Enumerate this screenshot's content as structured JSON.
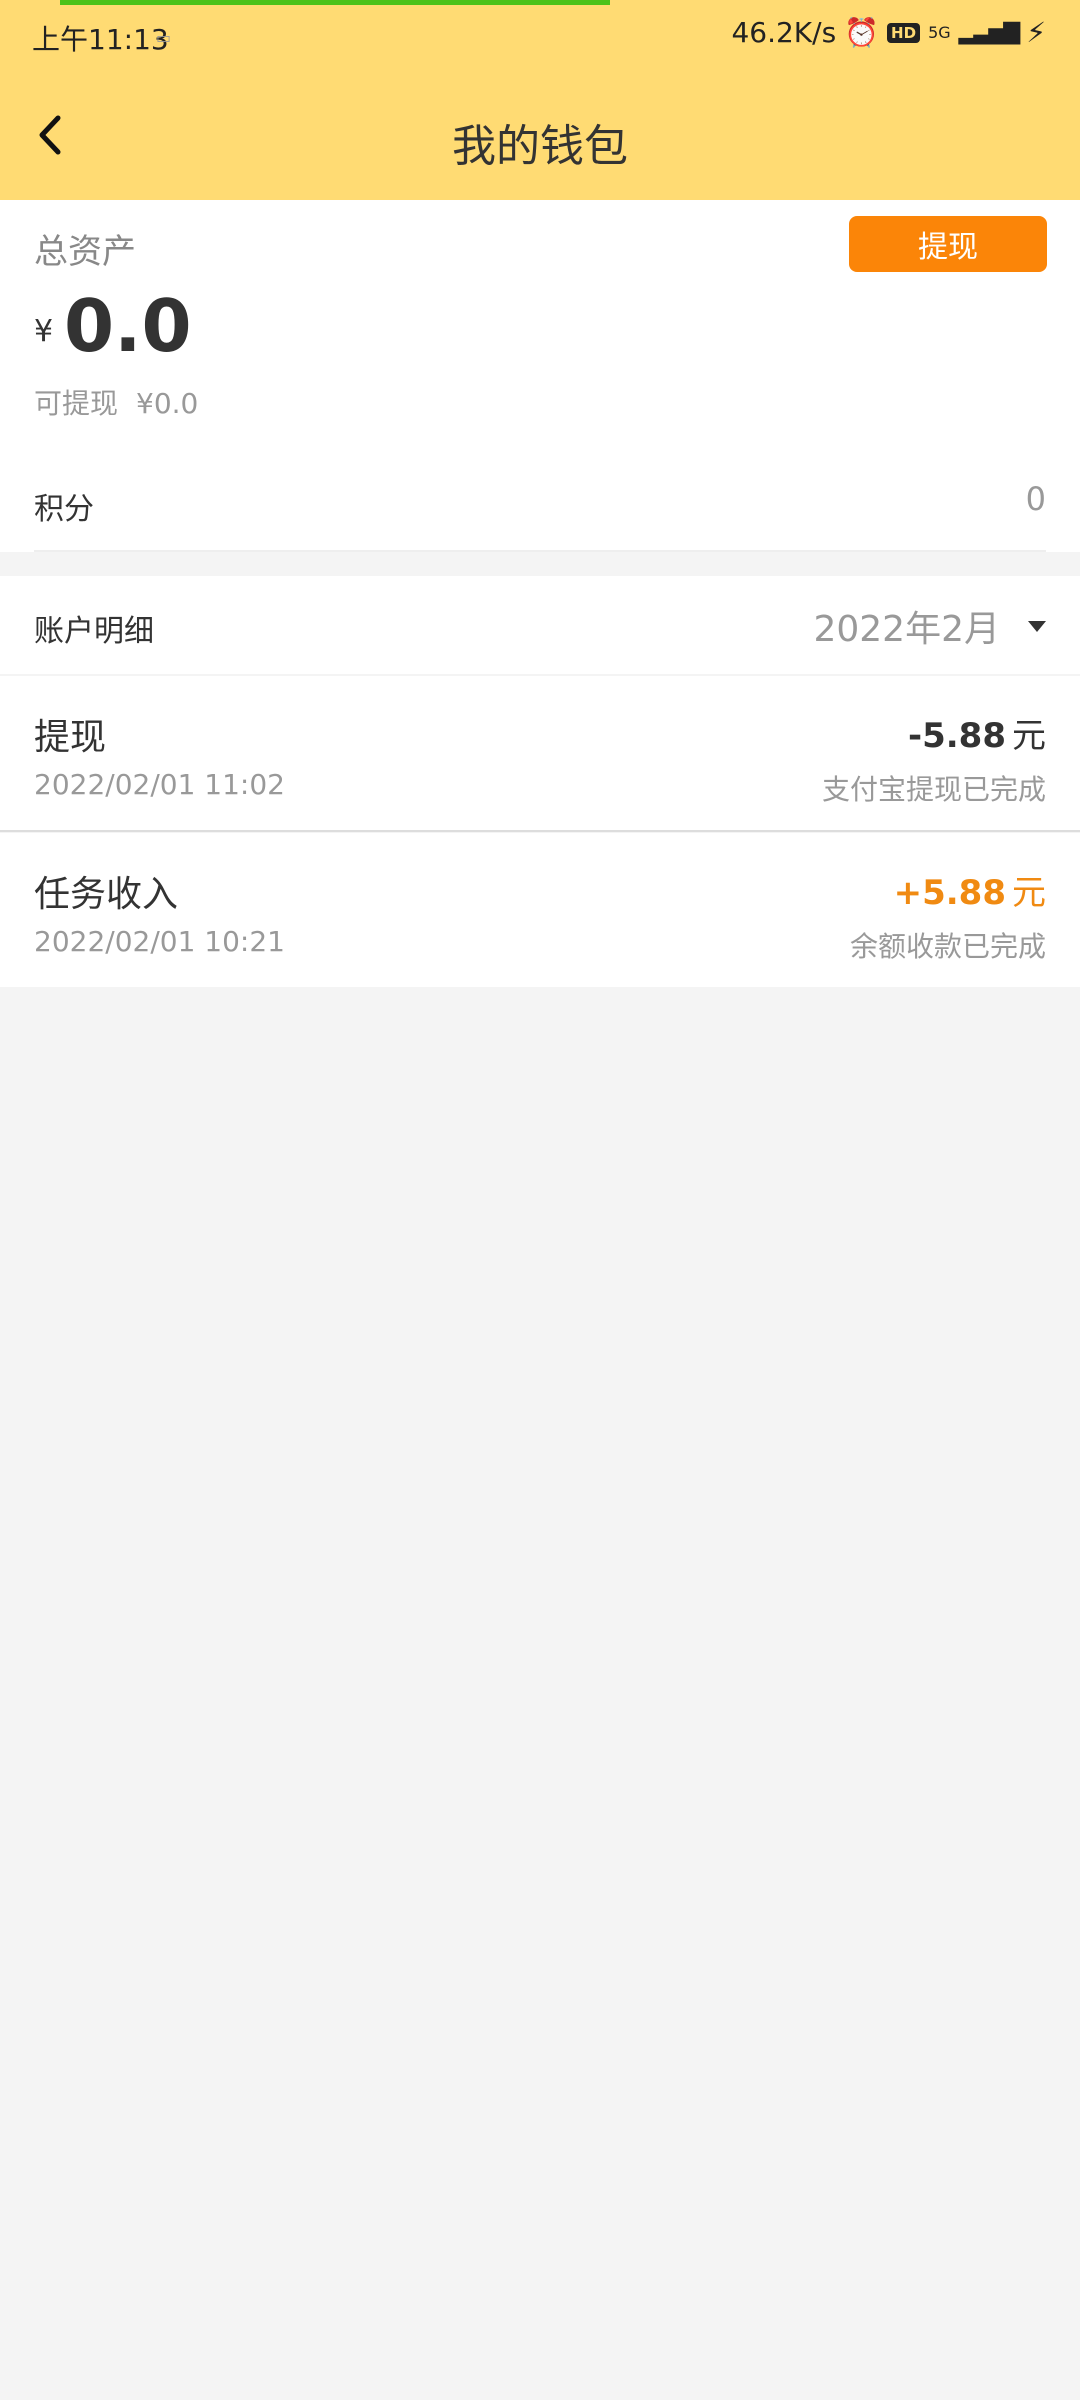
{
  "status_bar": {
    "time": "上午11:13",
    "network_speed": "46.2K/s",
    "hd_badge": "HD",
    "network_type": "5G"
  },
  "header": {
    "title": "我的钱包"
  },
  "assets": {
    "label": "总资产",
    "withdraw_button": "提现",
    "currency_symbol": "¥",
    "total_amount": "0.0",
    "withdrawable_label": "可提现",
    "withdrawable_amount": "¥0.0",
    "points_label": "积分",
    "points_value": "0"
  },
  "details": {
    "label": "账户明细",
    "month": "2022年2月"
  },
  "transactions": [
    {
      "title": "提现",
      "time": "2022/02/01 11:02",
      "amount": "-5.88",
      "unit": "元",
      "status": "支付宝提现已完成"
    },
    {
      "title": "任务收入",
      "time": "2022/02/01 10:21",
      "amount": "+5.88",
      "unit": "元",
      "status": "余额收款已完成"
    }
  ],
  "colors": {
    "header_bg": "#ffdb73",
    "accent": "#fb8508",
    "positive_amount": "#f08a12"
  }
}
